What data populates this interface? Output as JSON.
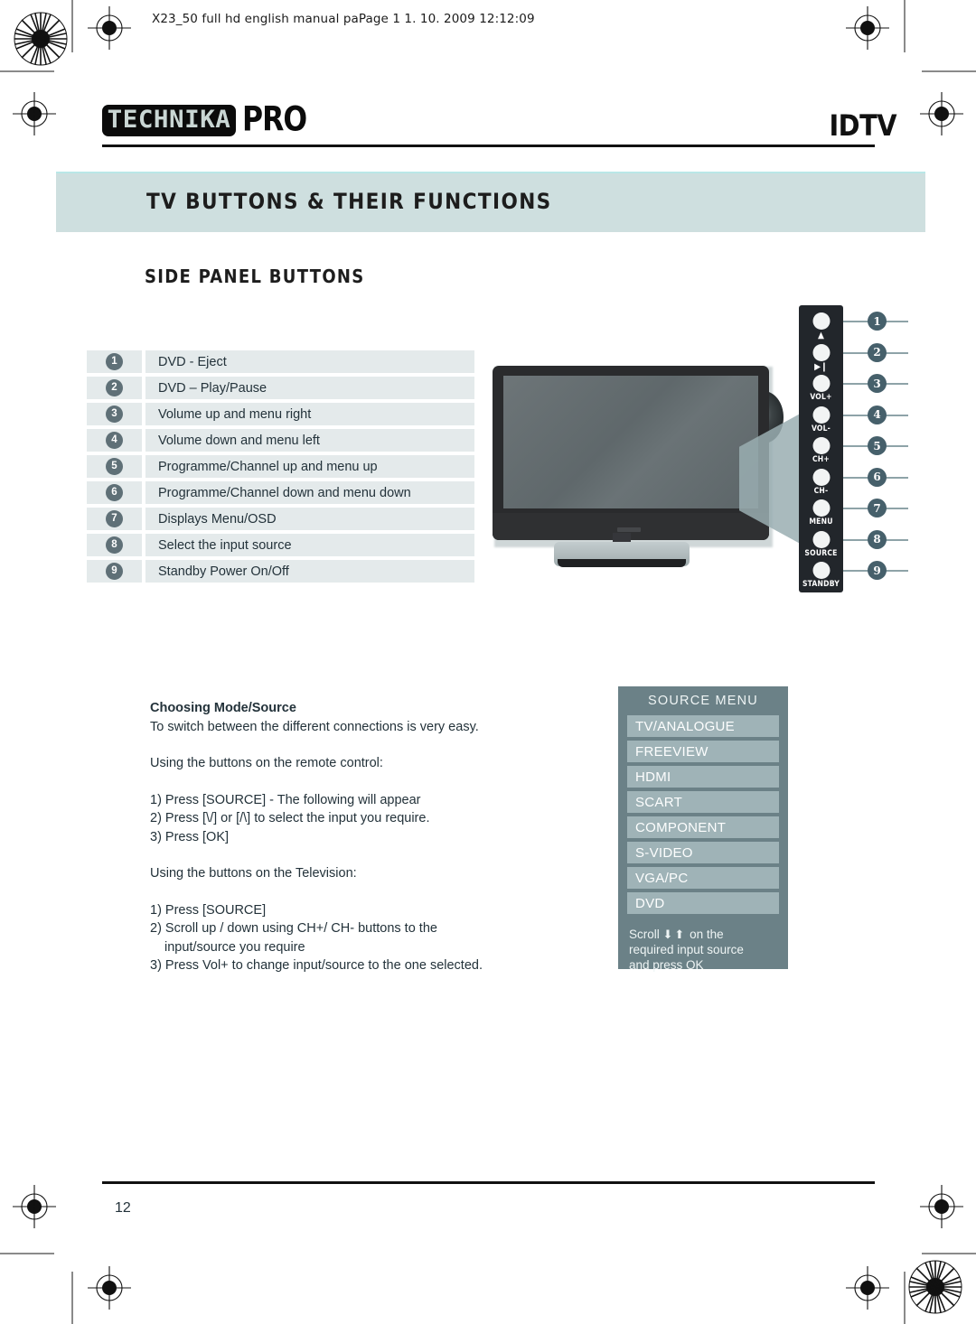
{
  "print_marks": {
    "file_stamp": "X23_50 full hd english manual paPage 1   1. 10. 2009   12:12:09"
  },
  "header": {
    "brand_name": "TECHNIKA",
    "brand_suffix": "PRO",
    "product_label": "IDTV"
  },
  "section": {
    "title": "TV BUTTONS & THEIR FUNCTIONS",
    "subtitle": "SIDE PANEL BUTTONS"
  },
  "function_list": [
    {
      "number": "1",
      "description": "DVD - Eject"
    },
    {
      "number": "2",
      "description": "DVD – Play/Pause"
    },
    {
      "number": "3",
      "description": "Volume up and menu right"
    },
    {
      "number": "4",
      "description": "Volume down and menu left"
    },
    {
      "number": "5",
      "description": "Programme/Channel up and menu up"
    },
    {
      "number": "6",
      "description": "Programme/Channel down and menu down"
    },
    {
      "number": "7",
      "description": "Displays Menu/OSD"
    },
    {
      "number": "8",
      "description": "Select the input source"
    },
    {
      "number": "9",
      "description": "Standby Power On/Off"
    }
  ],
  "side_panel": {
    "buttons": [
      {
        "number": "1",
        "label": "▲",
        "label_kind": "glyph",
        "name": "eject"
      },
      {
        "number": "2",
        "label": "▶❙",
        "label_kind": "glyph",
        "name": "play-pause"
      },
      {
        "number": "3",
        "label": "VOL+",
        "label_kind": "text",
        "name": "volume-up"
      },
      {
        "number": "4",
        "label": "VOL-",
        "label_kind": "text",
        "name": "volume-down"
      },
      {
        "number": "5",
        "label": "CH+",
        "label_kind": "text",
        "name": "channel-up"
      },
      {
        "number": "6",
        "label": "CH-",
        "label_kind": "text",
        "name": "channel-down"
      },
      {
        "number": "7",
        "label": "MENU",
        "label_kind": "text",
        "name": "menu"
      },
      {
        "number": "8",
        "label": "SOURCE",
        "label_kind": "text",
        "name": "source"
      },
      {
        "number": "9",
        "label": "STANDBY",
        "label_kind": "text",
        "name": "standby"
      }
    ]
  },
  "instructions": {
    "heading": "Choosing Mode/Source",
    "intro": "To switch between the different connections is very easy.",
    "remote_heading": "Using the buttons on the remote control:",
    "remote_steps": [
      "1) Press [SOURCE] - The following will appear",
      "2) Press [\\/] or [/\\] to select the input you require.",
      "3) Press [OK]"
    ],
    "tv_heading": "Using the buttons on the Television:",
    "tv_steps": [
      "1) Press [SOURCE]",
      "2) Scroll up / down using CH+/ CH- buttons to the",
      "input/source  you require",
      "3) Press Vol+ to change input/source to the one selected."
    ]
  },
  "source_menu": {
    "title": "SOURCE MENU",
    "items": [
      "TV/ANALOGUE",
      "FREEVIEW",
      "HDMI",
      "SCART",
      "COMPONENT",
      "S-VIDEO",
      "VGA/PC",
      "DVD"
    ],
    "footer_line1_a": "Scroll",
    "footer_arrows": "⬇⬆",
    "footer_line1_b": "on the",
    "footer_line2": "required input source",
    "footer_line3": "and press OK"
  },
  "footer": {
    "page_number": "12"
  },
  "colors": {
    "title_bar": "#cedfdf",
    "list_row": "#e4eaeb",
    "badge": "#5f7077",
    "callout_bubble": "#46606b",
    "osd_bg": "#6b8187",
    "osd_item": "#9fb3b7",
    "panel_body": "#22262b"
  }
}
